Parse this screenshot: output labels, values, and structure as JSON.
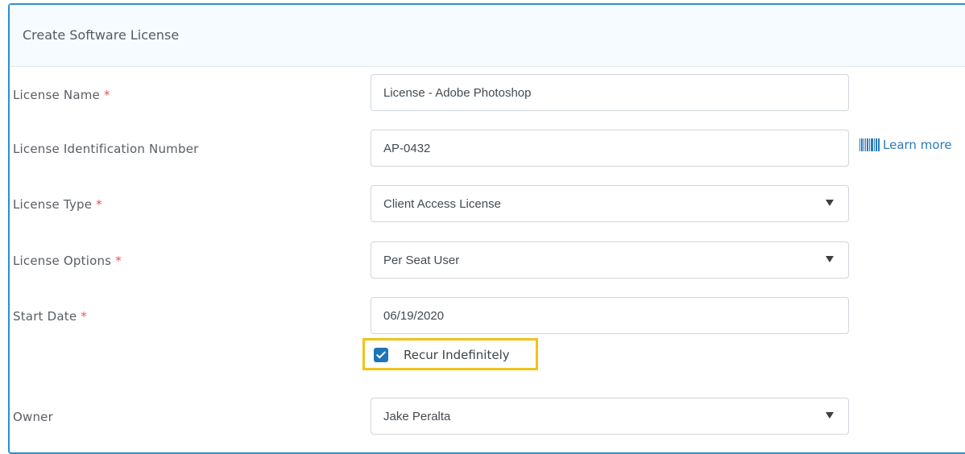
{
  "panel": {
    "title": "Create Software License"
  },
  "form": {
    "license_name": {
      "label": "License Name",
      "required_mark": "*",
      "value": "License - Adobe Photoshop"
    },
    "license_id": {
      "label": "License Identification Number",
      "value": "AP-0432",
      "learn_more": "Learn more"
    },
    "license_type": {
      "label": "License Type",
      "required_mark": "*",
      "selected": "Client Access License"
    },
    "license_options": {
      "label": "License Options",
      "required_mark": "*",
      "selected": "Per Seat User"
    },
    "start_date": {
      "label": "Start Date",
      "required_mark": "*",
      "value": "06/19/2020"
    },
    "recur": {
      "label": "Recur Indefinitely",
      "checked": true
    },
    "owner": {
      "label": "Owner",
      "selected": "Jake Peralta"
    }
  },
  "colors": {
    "panel_border": "#2a8fd4",
    "header_bg": "#f5fbfe",
    "required": "#e0584a",
    "link": "#2a7ab8",
    "checkbox": "#1f74b7",
    "highlight": "#f2c319"
  },
  "icons": {
    "barcode": "barcode-icon",
    "dropdown": "chevron-down-icon",
    "check": "check-icon"
  }
}
